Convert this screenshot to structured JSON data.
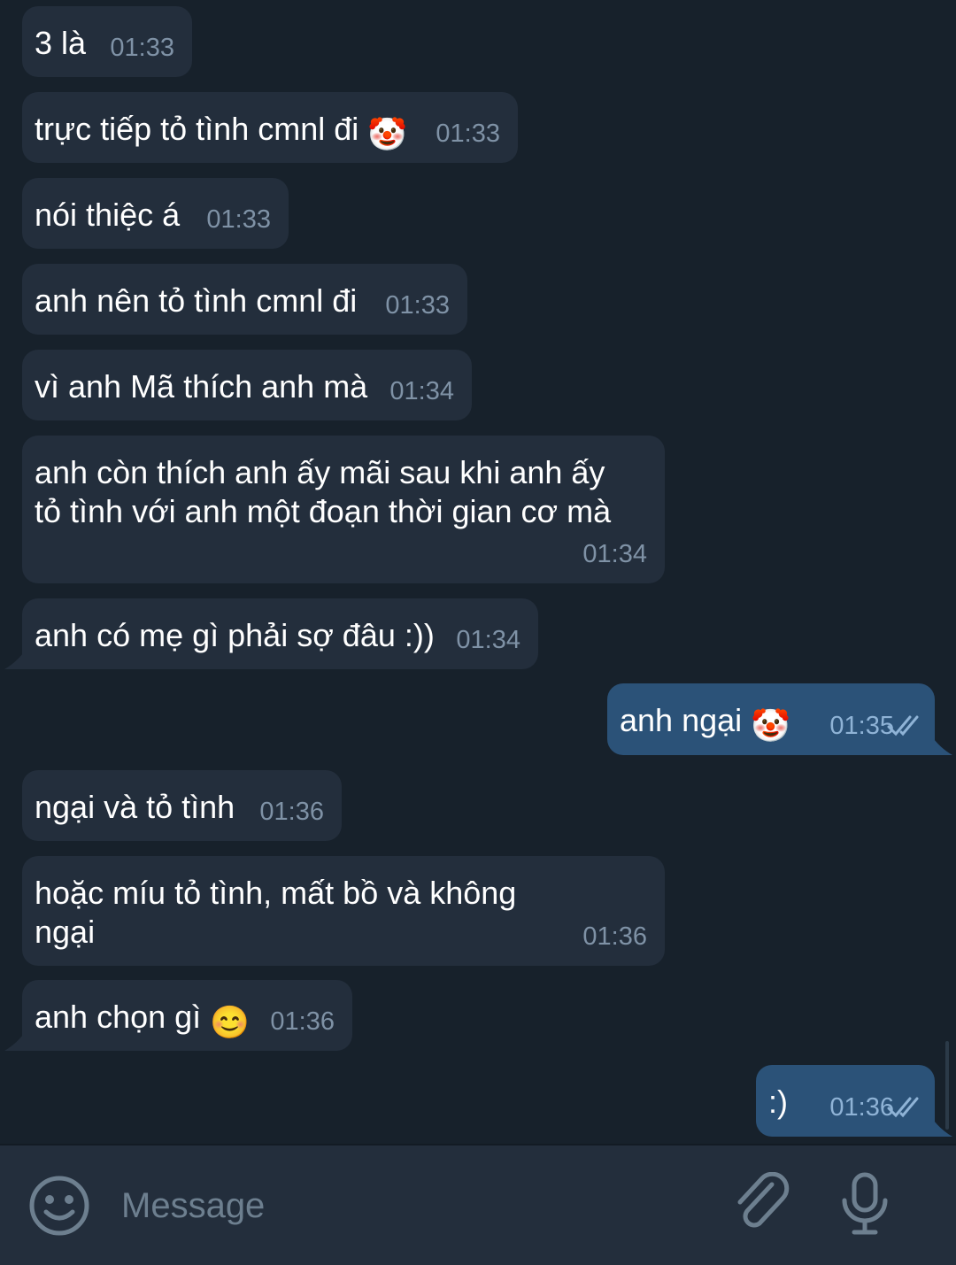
{
  "messages": [
    {
      "dir": "in",
      "text": "3 là",
      "time": "01:33"
    },
    {
      "dir": "in",
      "text": "trực tiếp tỏ tình cmnl đi",
      "emoji": "🤡",
      "time": "01:33"
    },
    {
      "dir": "in",
      "text": "nói thiệc á",
      "time": "01:33"
    },
    {
      "dir": "in",
      "text": "anh nên tỏ tình cmnl đi",
      "time": "01:33"
    },
    {
      "dir": "in",
      "text": "vì anh Mã thích anh mà",
      "time": "01:34"
    },
    {
      "dir": "in",
      "text": "anh còn thích anh ấy mãi sau khi anh ấy tỏ tình với anh một đoạn thời gian cơ mà",
      "time": "01:34"
    },
    {
      "dir": "in",
      "text": "anh có mẹ gì phải sợ đâu :))",
      "time": "01:34"
    },
    {
      "dir": "out",
      "text": "anh ngại",
      "emoji": "🤡",
      "time": "01:35",
      "status": "double-check-icon"
    },
    {
      "dir": "in",
      "text": "ngại và tỏ tình",
      "time": "01:36"
    },
    {
      "dir": "in",
      "text": "hoặc míu tỏ tình, mất bồ và không ngại",
      "time": "01:36"
    },
    {
      "dir": "in",
      "text": "anh chọn gì",
      "emoji": "😊",
      "time": "01:36"
    },
    {
      "dir": "out",
      "text": ":)",
      "time": "01:36",
      "status": "double-check-icon"
    }
  ],
  "composer": {
    "placeholder": "Message",
    "emoji_icon": "smile-icon",
    "attach_icon": "paperclip-icon",
    "mic_icon": "microphone-icon"
  },
  "colors": {
    "background": "#17212b",
    "incoming_bubble": "#232e3c",
    "outgoing_bubble": "#2b5278",
    "time_text": "#7f92a6",
    "composer_bg": "#232e3c"
  }
}
